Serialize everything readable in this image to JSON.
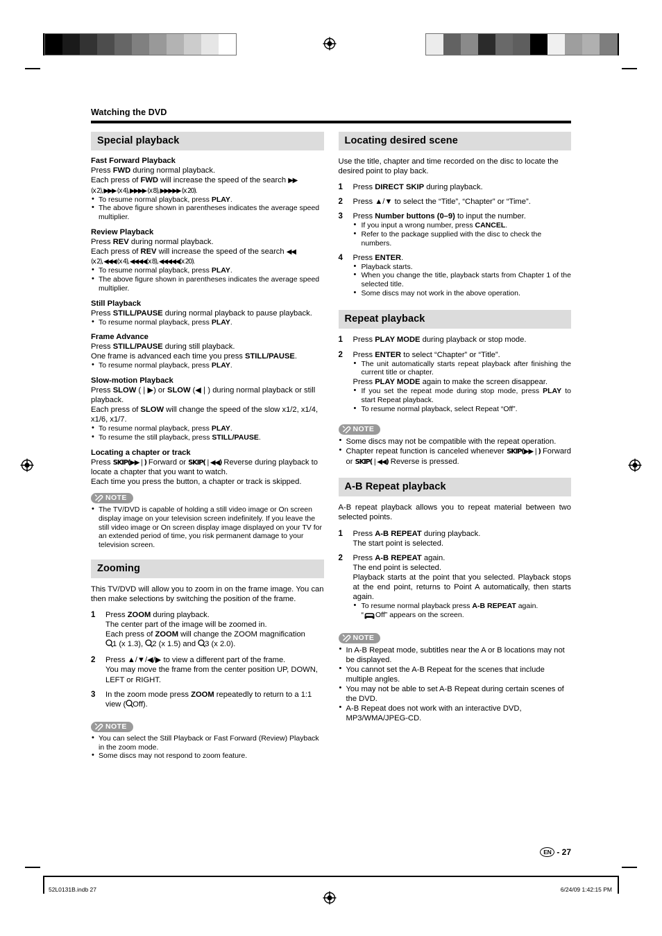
{
  "print_marks": {
    "left_swatches": [
      "#000000",
      "#1a1a1a",
      "#333333",
      "#4d4d4d",
      "#666666",
      "#808080",
      "#999999",
      "#b3b3b3",
      "#cccccc",
      "#e6e6e6",
      "#ffffff"
    ],
    "right_swatches": [
      "#ececec",
      "#626262",
      "#8a8a8a",
      "#2b2b2b",
      "#696969",
      "#5e5e5e",
      "#000000",
      "#f0f0f0",
      "#9e9e9e",
      "#b0b0b0",
      "#7e7e7e"
    ]
  },
  "running_head": "Watching the DVD",
  "left_column": {
    "special_playback": {
      "title": "Special playback",
      "fast_forward": {
        "heading": "Fast Forward Playback",
        "line1_a": "Press ",
        "line1_b": "FWD",
        "line1_c": " during normal playback.",
        "line2_a": "Each press of ",
        "line2_b": "FWD",
        "line2_c": " will increase the speed of the search ",
        "speeds": "(x 2), ▶▶▶ (x 4), ▶▶▶▶ (x 8), ▶▶▶▶▶ (x 20).",
        "bullets": [
          "To resume normal playback, press PLAY.",
          "The above figure shown in parentheses indicates the average speed multiplier."
        ]
      },
      "review": {
        "heading": "Review Playback",
        "line1_a": "Press ",
        "line1_b": "REV",
        "line1_c": " during normal playback.",
        "line2_a": "Each press of ",
        "line2_b": "REV",
        "line2_c": " will increase the speed of the search ",
        "speeds": "(x 2), ◀◀◀ (x 4), ◀◀◀◀(x 8), ◀◀◀◀◀(x 20).",
        "bullets": [
          "To resume normal playback, press PLAY.",
          "The above figure shown in parentheses indicates the average speed multiplier."
        ]
      },
      "still": {
        "heading": "Still Playback",
        "line1_a": "Press ",
        "line1_b": "STILL/PAUSE",
        "line1_c": " during normal playback to pause playback.",
        "bullets": [
          "To resume normal playback, press PLAY."
        ]
      },
      "frame_advance": {
        "heading": "Frame Advance",
        "line1_a": "Press ",
        "line1_b": "STILL/PAUSE",
        "line1_c": " during still playback.",
        "line2_a": "One frame is advanced each time you press ",
        "line2_b": "STILL/PAUSE",
        "line2_c": ".",
        "bullets": [
          "To resume normal playback, press PLAY."
        ]
      },
      "slow_motion": {
        "heading": "Slow-motion Playback",
        "line1_a": "Press ",
        "line1_b": "SLOW",
        "line1_c": " (❘▶) or ",
        "line1_d": "SLOW",
        "line1_e": " (◀❘) during normal playback or still playback.",
        "line2_a": "Each press of ",
        "line2_b": "SLOW",
        "line2_c": " will change the speed of the slow x1/2, x1/4, x1/6, x1/7.",
        "bullets": [
          "To resume normal playback, press PLAY.",
          "To resume the still playback, press STILL/PAUSE."
        ]
      },
      "locating_chapter": {
        "heading": "Locating a chapter or track",
        "line1_a": "Press ",
        "line1_b": "SKIP(▶▶❘)",
        "line1_c": " Forward or ",
        "line1_d": "SKIP(❘◀◀)",
        "line1_e": " Reverse during playback to locate a chapter that you want to watch.",
        "line2": "Each time you press the button, a chapter or track is skipped."
      },
      "note": {
        "label": "NOTE",
        "bullets": [
          "The TV/DVD is capable of holding a still video image or On screen display image on your television screen indefinitely. If you leave the still video image or On screen display image displayed on your TV for an extended period of time, you risk permanent damage to your television screen."
        ]
      }
    },
    "zooming": {
      "title": "Zooming",
      "intro": "This TV/DVD will allow you to zoom in on the frame image. You can then make selections by switching the position of the frame.",
      "steps": [
        {
          "num": "1",
          "main_a": "Press ",
          "main_b": "ZOOM",
          "main_c": " during playback.",
          "sub1": "The center part of the image will be zoomed in.",
          "sub2_a": "Each press of ",
          "sub2_b": "ZOOM",
          "sub2_c": " will change the ZOOM magnification",
          "sub3_1": "1 (x 1.3),",
          "sub3_2": "2 (x 1.5) and",
          "sub3_3": "3 (x 2.0)."
        },
        {
          "num": "2",
          "main": "Press ▲/▼/◀/▶ to view a different part of the frame.",
          "sub1": "You may move the frame from the center position UP, DOWN, LEFT or RIGHT."
        },
        {
          "num": "3",
          "main_a": "In the zoom mode press ",
          "main_b": "ZOOM",
          "main_c": " repeatedly to return to a 1:1 view (",
          "main_d": "Off)."
        }
      ],
      "note": {
        "label": "NOTE",
        "bullets": [
          "You can select the Still Playback or Fast Forward (Review) Playback in the zoom mode.",
          "Some discs may not respond to zoom feature."
        ]
      }
    }
  },
  "right_column": {
    "locating_scene": {
      "title": "Locating desired scene",
      "intro": "Use the title, chapter and time recorded on the disc to locate the desired point to play back.",
      "steps": [
        {
          "num": "1",
          "main_a": "Press ",
          "main_b": "DIRECT SKIP",
          "main_c": " during playback."
        },
        {
          "num": "2",
          "main": "Press ▲/▼ to select the “Title”, “Chapter” or “Time”."
        },
        {
          "num": "3",
          "main_a": "Press ",
          "main_b": "Number buttons (0–9)",
          "main_c": " to input the number.",
          "bullets": [
            "If you input a wrong number, press CANCEL.",
            "Refer to the package supplied with the disc to check the numbers."
          ]
        },
        {
          "num": "4",
          "main_a": "Press ",
          "main_b": "ENTER",
          "main_c": ".",
          "bullets": [
            "Playback starts.",
            "When you change the title, playback starts from Chapter 1 of the selected title.",
            "Some discs may not work in the above operation."
          ]
        }
      ]
    },
    "repeat_playback": {
      "title": "Repeat playback",
      "steps": [
        {
          "num": "1",
          "main_a": "Press ",
          "main_b": "PLAY MODE",
          "main_c": " during playback or stop mode."
        },
        {
          "num": "2",
          "main_a": "Press ",
          "main_b": "ENTER",
          "main_c": " to select “Chapter” or “Title”.",
          "bullets_top": [
            "The unit automatically starts repeat playback after finishing the current title or chapter."
          ],
          "para_a": "Press ",
          "para_b": "PLAY MODE",
          "para_c": " again to make the screen disappear.",
          "bullets": [
            "If you set the repeat mode during stop mode, press PLAY to start Repeat playback.",
            "To resume normal playback, select Repeat “Off”."
          ]
        }
      ],
      "note": {
        "label": "NOTE",
        "bullets": [
          "Some discs may not be compatible with the repeat operation.",
          "Chapter repeat function is canceled whenever SKIP(▶▶❘) Forward or SKIP(❘◀◀) Reverse is pressed."
        ]
      }
    },
    "ab_repeat": {
      "title": "A-B Repeat playback",
      "intro": "A-B repeat playback allows you to repeat material between two selected points.",
      "steps": [
        {
          "num": "1",
          "main_a": "Press ",
          "main_b": "A-B REPEAT",
          "main_c": " during playback.",
          "sub1": "The start point is selected."
        },
        {
          "num": "2",
          "main_a": "Press ",
          "main_b": "A-B REPEAT",
          "main_c": " again.",
          "sub1": "The end point is selected.",
          "sub2": "Playback starts at the point that you selected. Playback stops at the end point, returns to Point A automatically, then starts again.",
          "bullet_a": "To resume normal playback press ",
          "bullet_b": "A-B REPEAT",
          "bullet_c": " again.",
          "bullet_off": "Off” appears on the screen."
        }
      ],
      "note": {
        "label": "NOTE",
        "bullets": [
          "In A-B Repeat mode, subtitles near the A or B locations may not be displayed.",
          "You cannot set the A-B Repeat for the scenes that include multiple angles.",
          "You may not be able to set A-B Repeat during certain scenes of the DVD.",
          "A-B Repeat does not work with an interactive DVD, MP3/WMA/JPEG-CD."
        ]
      }
    }
  },
  "footer": {
    "lang_badge": "EN",
    "page_number": "- 27",
    "file_name": "52L0131B.indb  27",
    "timestamp": "6/24/09   1:42:15 PM"
  }
}
